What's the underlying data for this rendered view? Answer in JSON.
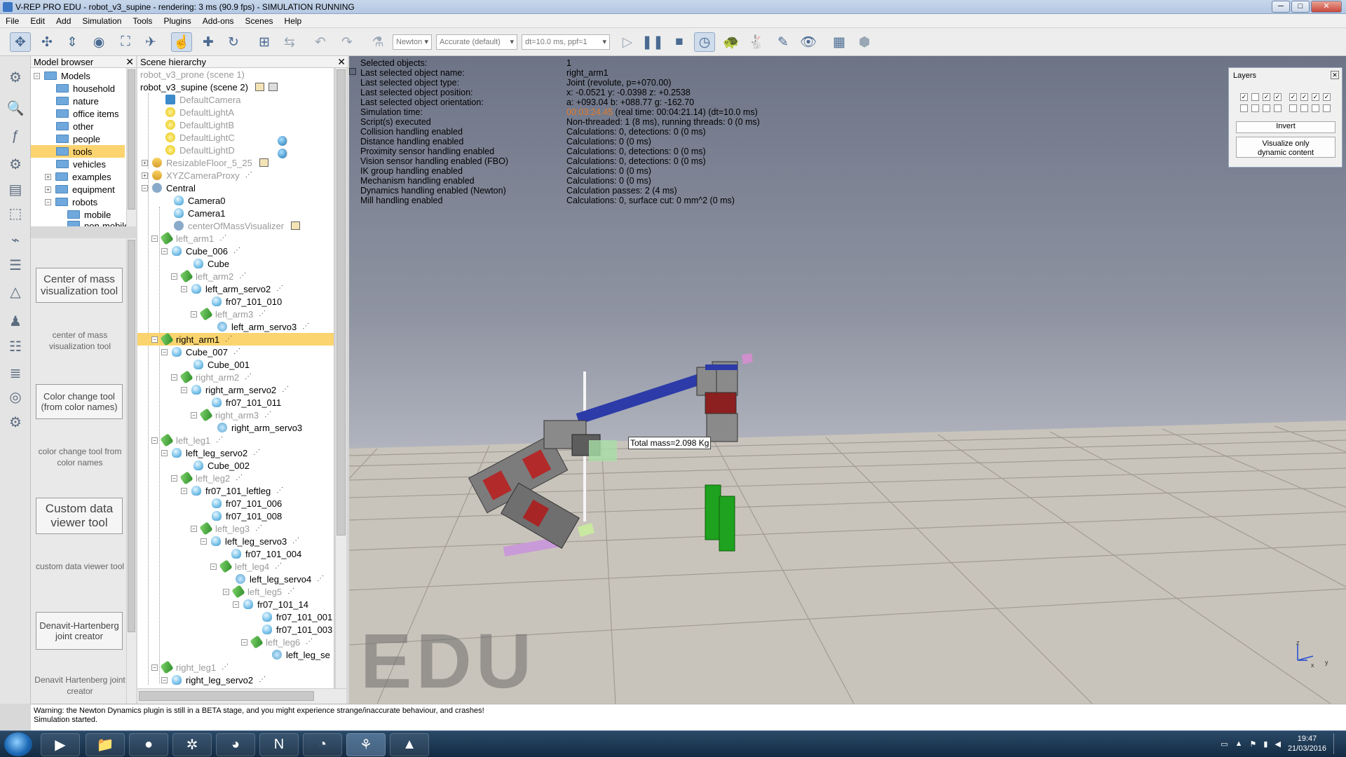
{
  "window": {
    "title": "V-REP PRO EDU - robot_v3_supine - rendering: 3 ms (90.9 fps) - SIMULATION RUNNING"
  },
  "menu": [
    "File",
    "Edit",
    "Add",
    "Simulation",
    "Tools",
    "Plugins",
    "Add-ons",
    "Scenes",
    "Help"
  ],
  "toolbar": {
    "engine": "Newton",
    "accuracy": "Accurate (default)",
    "timestep": "dt=10.0 ms, ppf=1"
  },
  "model_browser": {
    "title": "Model browser",
    "items": [
      "Models",
      "household",
      "nature",
      "office items",
      "other",
      "people",
      "tools",
      "vehicles",
      "examples",
      "equipment",
      "robots",
      "mobile",
      "non-mobile"
    ],
    "selected": "tools",
    "tools": [
      {
        "button": "Center of mass visualization tool",
        "desc": "center of mass visualization tool"
      },
      {
        "button": "Color change tool (from color names)",
        "desc": "color change tool from color names"
      },
      {
        "button": "Custom data viewer tool",
        "desc": "custom data viewer tool"
      },
      {
        "button": "Denavit-Hartenberg joint creator",
        "desc": "Denavit Hartenberg joint creator"
      }
    ]
  },
  "scene_hierarchy": {
    "title": "Scene hierarchy",
    "rows": [
      "robot_v3_prone (scene 1)",
      "robot_v3_supine (scene 2)",
      "DefaultCamera",
      "DefaultLightA",
      "DefaultLightB",
      "DefaultLightC",
      "DefaultLightD",
      "ResizableFloor_5_25",
      "XYZCameraProxy",
      "Central",
      "Camera0",
      "Camera1",
      "centerOfMassVisualizer",
      "left_arm1",
      "Cube_006",
      "Cube",
      "left_arm2",
      "left_arm_servo2",
      "fr07_101_010",
      "left_arm3",
      "left_arm_servo3",
      "right_arm1",
      "Cube_007",
      "Cube_001",
      "right_arm2",
      "right_arm_servo2",
      "fr07_101_011",
      "right_arm3",
      "right_arm_servo3",
      "left_leg1",
      "left_leg_servo2",
      "Cube_002",
      "left_leg2",
      "fr07_101_leftleg",
      "fr07_101_006",
      "fr07_101_008",
      "left_leg3",
      "left_leg_servo3",
      "fr07_101_004",
      "left_leg4",
      "left_leg_servo4",
      "left_leg5",
      "fr07_101_14",
      "fr07_101_001",
      "fr07_101_003",
      "left_leg6",
      "left_leg_se",
      "right_leg1",
      "right_leg_servo2"
    ],
    "selected": "right_arm1"
  },
  "info": {
    "rows": [
      {
        "k": "Selected objects:",
        "v": "1"
      },
      {
        "k": "Last selected object name:",
        "v": "right_arm1"
      },
      {
        "k": "Last selected object type:",
        "v": "Joint (revolute, p=+070.00)"
      },
      {
        "k": "Last selected object position:",
        "v": "x: -0.0521    y: -0.0398    z: +0.2538"
      },
      {
        "k": "Last selected object orientation:",
        "v": "a: +093.04    b: +088.77    g: -162.70"
      },
      {
        "k": "Simulation time:",
        "v": "(real time: 00:04:21.14) (dt=10.0 ms)",
        "v_highlight": "00:03:24.45"
      },
      {
        "k": "Script(s) executed",
        "v": "Non-threaded: 1 (8 ms), running threads: 0 (0 ms)"
      },
      {
        "k": "Collision handling enabled",
        "v": "Calculations: 0, detections: 0 (0 ms)"
      },
      {
        "k": "Distance handling enabled",
        "v": "Calculations: 0 (0 ms)"
      },
      {
        "k": "Proximity sensor handling enabled",
        "v": "Calculations: 0, detections: 0 (0 ms)"
      },
      {
        "k": "Vision sensor handling enabled (FBO)",
        "v": "Calculations: 0, detections: 0 (0 ms)"
      },
      {
        "k": "IK group handling enabled",
        "v": "Calculations: 0 (0 ms)"
      },
      {
        "k": "Mechanism handling enabled",
        "v": "Calculations: 0 (0 ms)"
      },
      {
        "k": "Dynamics handling enabled (Newton)",
        "v": "Calculation passes: 2 (4 ms)"
      },
      {
        "k": "Mill handling enabled",
        "v": "Calculations: 0, surface cut: 0 mm^2 (0 ms)"
      }
    ]
  },
  "layers": {
    "title": "Layers",
    "invert": "Invert",
    "visualize": "Visualize only dynamic content"
  },
  "viewport": {
    "watermark": "EDU",
    "mass_label": "Total mass=2.098 Kg",
    "axes": {
      "x": "x",
      "y": "y",
      "z": "z"
    }
  },
  "status": {
    "line1": "Warning: the Newton Dynamics plugin is still in a BETA stage, and you might experience strange/inaccurate behaviour, and crashes!",
    "line2": "Simulation started."
  },
  "taskbar": {
    "time": "19:47",
    "date": "21/03/2016"
  }
}
